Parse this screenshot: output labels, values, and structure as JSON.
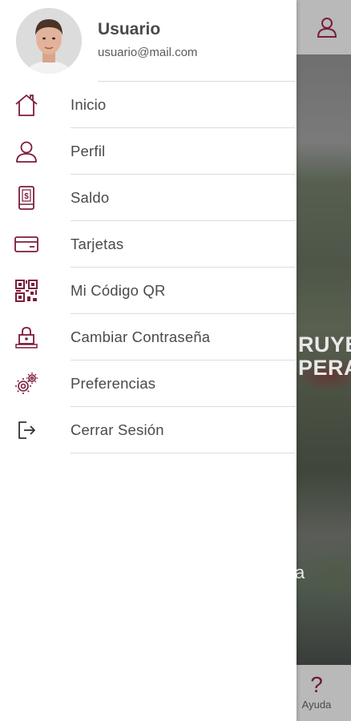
{
  "user": {
    "name": "Usuario",
    "email": "usuario@mail.com"
  },
  "menu": {
    "items": [
      {
        "label": "Inicio",
        "icon": "home-icon"
      },
      {
        "label": "Perfil",
        "icon": "person-icon"
      },
      {
        "label": "Saldo",
        "icon": "balance-phone-icon"
      },
      {
        "label": "Tarjetas",
        "icon": "card-icon"
      },
      {
        "label": "Mi Código QR",
        "icon": "qr-code-icon"
      },
      {
        "label": "Cambiar Contraseña",
        "icon": "lock-password-icon"
      },
      {
        "label": "Preferencias",
        "icon": "gears-icon"
      },
      {
        "label": "Cerrar Sesión",
        "icon": "logout-icon"
      }
    ]
  },
  "background": {
    "banner_text_line1": "RUYE",
    "banner_text_line2": "PERA",
    "overlay_fragment": "a",
    "help_label": "Ayuda"
  },
  "colors": {
    "accent": "#7b1c3a",
    "text": "#4a4a4a",
    "divider": "#dcdcdc"
  }
}
